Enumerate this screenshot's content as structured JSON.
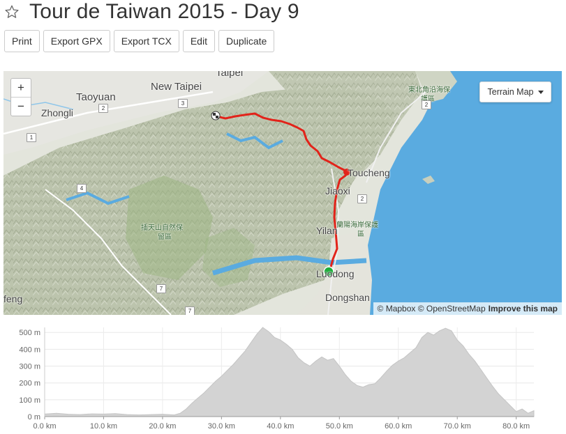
{
  "header": {
    "title": "Tour de Taiwan 2015 - Day 9",
    "star_icon": "star-outline-icon"
  },
  "toolbar": {
    "print": "Print",
    "export_gpx": "Export GPX",
    "export_tcx": "Export TCX",
    "edit": "Edit",
    "duplicate": "Duplicate"
  },
  "map": {
    "zoom_in": "+",
    "zoom_out": "−",
    "map_type": "Terrain Map",
    "attribution_mapbox": "© Mapbox",
    "attribution_osm": "© OpenStreetMap",
    "attribution_improve": "Improve this map",
    "route_color": "#e2231a",
    "start_color": "#1fae3c",
    "labels": {
      "taipei": "Taipei",
      "new_taipei": "New Taipei",
      "taoyuan": "Taoyuan",
      "zhongli": "Zhongli",
      "toucheng": "Toucheng",
      "jiaoxi": "Jiaoxi",
      "yilan": "Yilan",
      "luodong": "Luodong",
      "dongshan": "Dongshan",
      "fengbin_partial": "feng",
      "reserve_northeast": "東北角沿海保",
      "reserve_northeast_2": "護區",
      "reserve_lanyang": "蘭陽海岸保護",
      "reserve_lanyang_2": "區",
      "reserve_chatian": "插天山自然保",
      "reserve_chatian_2": "留區"
    },
    "road_shields": [
      "3",
      "2",
      "2",
      "1",
      "4",
      "2",
      "7",
      "7"
    ]
  },
  "chart_data": {
    "type": "area",
    "title": "",
    "xlabel": "",
    "ylabel": "",
    "xlim": [
      0,
      83
    ],
    "ylim": [
      0,
      530
    ],
    "x_ticks": [
      "0.0 km",
      "10.0 km",
      "20.0 km",
      "30.0 km",
      "40.0 km",
      "50.0 km",
      "60.0 km",
      "70.0 km",
      "80.0 km"
    ],
    "y_ticks": [
      "0 m",
      "100 m",
      "200 m",
      "300 m",
      "400 m",
      "500 m"
    ],
    "grid": true,
    "fill_color": "#d3d3d3",
    "series": [
      {
        "x": [
          0,
          2,
          4,
          6,
          8,
          10,
          12,
          14,
          16,
          18,
          20,
          22,
          23,
          24,
          25,
          26,
          27,
          28,
          29,
          30,
          31,
          32,
          33,
          34,
          35,
          36,
          37,
          38,
          39,
          40,
          41,
          42,
          43,
          44,
          45,
          46,
          47,
          48,
          49,
          50,
          51,
          52,
          53,
          54,
          55,
          56,
          57,
          58,
          59,
          60,
          61,
          62,
          63,
          64,
          65,
          66,
          67,
          68,
          69,
          70,
          71,
          72,
          73,
          74,
          75,
          76,
          77,
          78,
          79,
          80,
          81,
          82,
          83
        ],
        "values": [
          15,
          20,
          14,
          12,
          16,
          15,
          18,
          12,
          10,
          12,
          14,
          10,
          20,
          45,
          80,
          110,
          140,
          175,
          210,
          240,
          275,
          310,
          350,
          390,
          440,
          490,
          530,
          505,
          470,
          455,
          430,
          400,
          350,
          320,
          300,
          330,
          355,
          335,
          345,
          300,
          250,
          210,
          185,
          175,
          190,
          195,
          230,
          270,
          305,
          330,
          350,
          380,
          410,
          470,
          500,
          485,
          510,
          525,
          510,
          455,
          420,
          370,
          330,
          280,
          230,
          180,
          135,
          100,
          65,
          30,
          45,
          20,
          35
        ]
      }
    ]
  }
}
